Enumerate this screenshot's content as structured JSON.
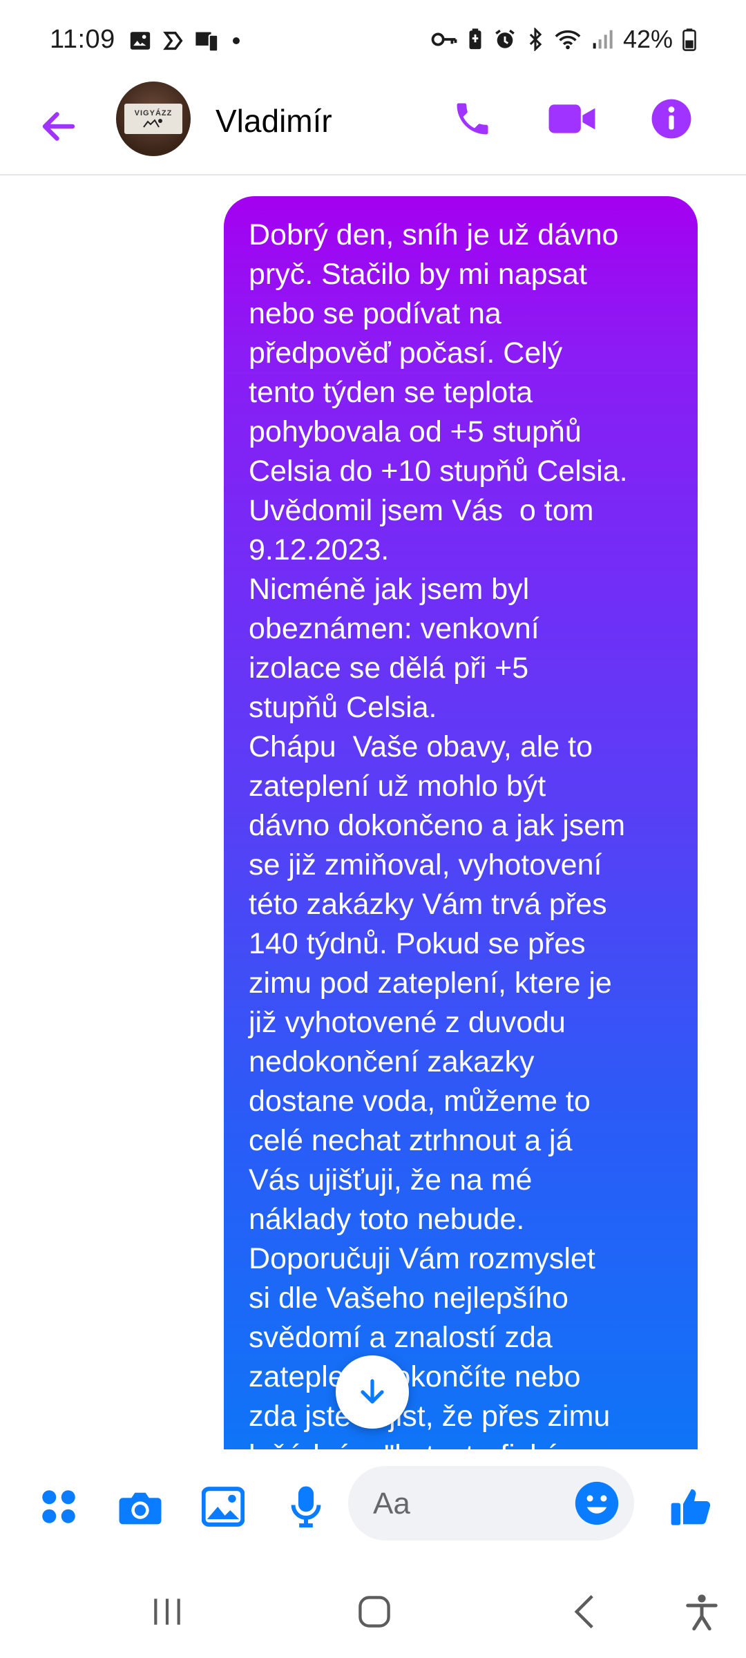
{
  "status_bar": {
    "time": "11:09",
    "battery": "42%",
    "left_icons": [
      "image-icon",
      "signal-app-icon",
      "phone-screen-icon",
      "dot-icon"
    ],
    "right_icons": [
      "key-icon",
      "battery-saver-icon",
      "alarm-icon",
      "bluetooth-icon",
      "wifi-icon",
      "cell-signal-icon",
      "battery-icon"
    ]
  },
  "header": {
    "contact_name": "Vladimír",
    "avatar_sign_text": "VIGYÁZZ",
    "icons": [
      "back-arrow-icon",
      "phone-icon",
      "video-icon",
      "info-icon"
    ]
  },
  "conversation": {
    "messages": [
      {
        "direction": "outgoing",
        "text": "Dobrý den, sníh je už dávno\npryč. Stačilo by mi napsat\nnebo se podívat na\npředpověď počasí. Celý\ntento týden se teplota\npohybovala od +5 stupňů\nCelsia do +10 stupňů Celsia.\nUvědomil jsem Vás  o tom\n9.12.2023.\nNicméně jak jsem byl\nobeznámen: venkovní\nizolace se dělá při +5\nstupňů Celsia.\nChápu  Vaše obavy, ale to\nzateplení už mohlo být\ndávno dokončeno a jak jsem\nse již zmiňoval, vyhotovení\ntéto zakázky Vám trvá přes\n140 týdnů. Pokud se přes\nzimu pod zateplení, ktere je\njiž vyhotovené z duvodu\nnedokončení zakazky\ndostane voda, můžeme to\ncelé nechat ztrhnout a já\nVás ujišťuji, že na mé\nnáklady toto nebude.\nDoporučuji Vám rozmyslet\nsi dle Vašeho nejlepšího\nsvědomí a znalostí zda\nzateplení dokončíte nebo\nzda jste si jist, že přes zimu\nk žádným \"katastrofickým"
      }
    ]
  },
  "composer": {
    "placeholder": "Aa",
    "icons": [
      "apps-grid-icon",
      "camera-icon",
      "gallery-icon",
      "microphone-icon",
      "emoji-icon",
      "thumbs-up-icon"
    ]
  },
  "navbar": {
    "icons": [
      "recent-apps-icon",
      "home-icon",
      "back-icon",
      "accessibility-icon"
    ]
  },
  "colors": {
    "accent": "#a033ff",
    "bubble_top": "#a400f0",
    "bubble_bottom": "#0a79f7",
    "composer_icons": "#0a7cff"
  }
}
